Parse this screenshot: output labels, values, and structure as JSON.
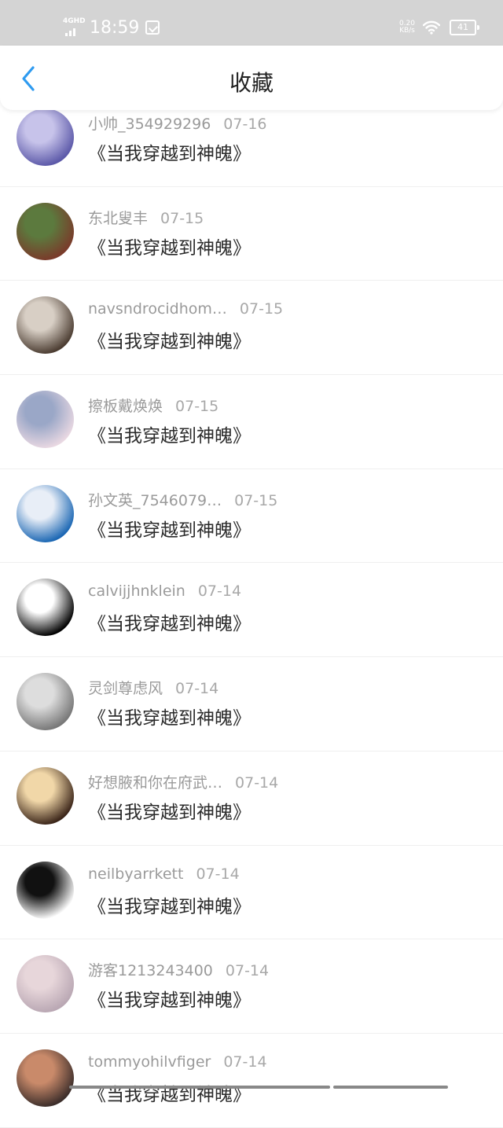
{
  "status_bar": {
    "network": "4GHD",
    "time": "18:59",
    "speed_value": "0.20",
    "speed_unit": "KB/s",
    "battery": "41"
  },
  "header": {
    "title": "收藏"
  },
  "items": [
    {
      "user": "小帅_354929296",
      "date": "07-16",
      "book": "《当我穿越到神魄》",
      "avatar_colors": [
        "#5b58a8",
        "#c7c3ea"
      ]
    },
    {
      "user": "东北叟丰",
      "date": "07-15",
      "book": "《当我穿越到神魄》",
      "avatar_colors": [
        "#7a3a2a",
        "#5c7a3e"
      ]
    },
    {
      "user": "navsndrocidhom…",
      "date": "07-15",
      "book": "《当我穿越到神魄》",
      "avatar_colors": [
        "#4a3b30",
        "#d8cfc5"
      ]
    },
    {
      "user": "擦板戴焕焕",
      "date": "07-15",
      "book": "《当我穿越到神魄》",
      "avatar_colors": [
        "#e9d8e2",
        "#9aa7c7"
      ]
    },
    {
      "user": "孙文英_7546079…",
      "date": "07-15",
      "book": "《当我穿越到神魄》",
      "avatar_colors": [
        "#1a66b3",
        "#e8eef7"
      ]
    },
    {
      "user": "calvijjhnklein",
      "date": "07-14",
      "book": "《当我穿越到神魄》",
      "avatar_colors": [
        "#000000",
        "#ffffff"
      ]
    },
    {
      "user": "灵剑尊虑风",
      "date": "07-14",
      "book": "《当我穿越到神魄》",
      "avatar_colors": [
        "#777777",
        "#dddddd"
      ]
    },
    {
      "user": "好想腋和你在府武…",
      "date": "07-14",
      "book": "《当我穿越到神魄》",
      "avatar_colors": [
        "#3a2418",
        "#f1d7a8"
      ]
    },
    {
      "user": "neilbyarrkett",
      "date": "07-14",
      "book": "《当我穿越到神魄》",
      "avatar_colors": [
        "#ffffff",
        "#111111"
      ]
    },
    {
      "user": "游客1213243400",
      "date": "07-14",
      "book": "《当我穿越到神魄》",
      "avatar_colors": [
        "#b9a7b3",
        "#e7d6da"
      ]
    },
    {
      "user": "tommyohilvfiger",
      "date": "07-14",
      "book": "《当我穿越到神魄》",
      "avatar_colors": [
        "#3b2d2a",
        "#c98a6a"
      ]
    }
  ],
  "colors": {
    "accent": "#2f9bf0",
    "status_bar_bg": "#d4d4d4",
    "meta_text": "#9a9a9a",
    "book_text": "#2b2b2b"
  }
}
